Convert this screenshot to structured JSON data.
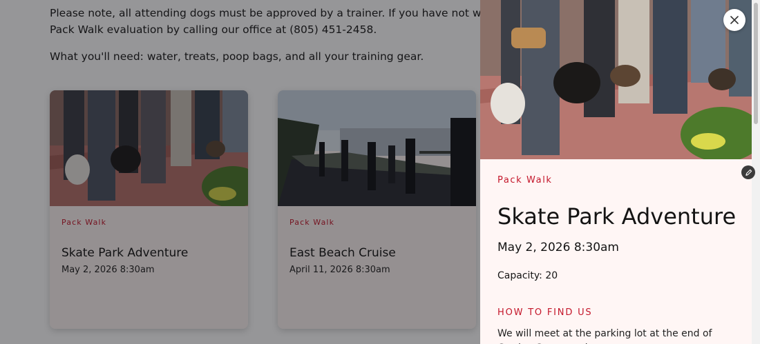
{
  "intro": {
    "note": "Please note, all attending dogs must be approved by a trainer. If you have not worked w Pack Walk evaluation by calling our office at (805) 451-2458.",
    "note_line1": "Please note, all attending dogs must be approved by a trainer. If you have not worked w",
    "note_line2": "Pack Walk evaluation by calling our office at (805) 451-2458.",
    "needs": "What you'll need: water, treats, poop bags, and all your training gear."
  },
  "events": [
    {
      "tag": "Pack Walk",
      "title": "Skate Park Adventure",
      "date": "May 2, 2026 8:30am"
    },
    {
      "tag": "Pack Walk",
      "title": "East Beach Cruise",
      "date": "April 11, 2026 8:30am"
    }
  ],
  "panel": {
    "tag": "Pack Walk",
    "title": "Skate Park Adventure",
    "date": "May 2, 2026 8:30am",
    "capacity": "Capacity: 20",
    "how_heading": "HOW TO FIND US",
    "how_text": "We will meet at the parking lot at the end of Garden Street to the"
  },
  "icons": {
    "close": "close-icon",
    "edit": "pencil-icon"
  },
  "colors": {
    "accent": "#c4162a",
    "panel_bg": "#fff6f5",
    "card_bg": "#fdf5f3"
  }
}
